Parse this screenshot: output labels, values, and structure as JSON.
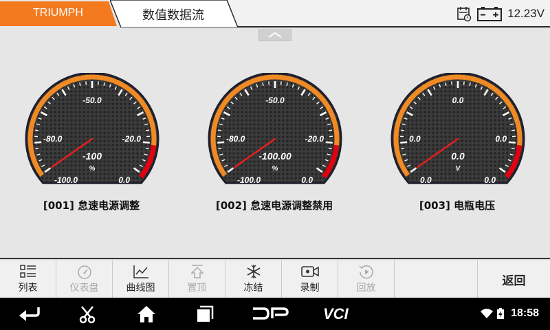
{
  "header": {
    "brand": "TRIUMPH",
    "title": "数值数据流",
    "voltage": "12.23V",
    "icons": [
      "calendar-clock-icon",
      "battery-icon"
    ]
  },
  "gauges": [
    {
      "ticks": {
        "top": "-50.0",
        "left": "-80.0",
        "right": "-20.0",
        "bottom_left": "-100.0",
        "bottom_right": "0.0"
      },
      "value": "-100",
      "unit": "%",
      "label": "[001] 怠速电源调整"
    },
    {
      "ticks": {
        "top": "-50.0",
        "left": "-80.0",
        "right": "-20.0",
        "bottom_left": "-100.0",
        "bottom_right": "0.0"
      },
      "value": "-100.00",
      "unit": "%",
      "label": "[002] 怠速电源调整禁用"
    },
    {
      "ticks": {
        "top": "0.0",
        "left": "0.0",
        "right": "0.0",
        "bottom_left": "0.0",
        "bottom_right": "0.0"
      },
      "value": "0.0",
      "unit": "V",
      "label": "[003] 电瓶电压"
    }
  ],
  "toolbar": {
    "items": [
      {
        "label": "列表",
        "icon": "list-icon",
        "enabled": true
      },
      {
        "label": "仪表盘",
        "icon": "gauge-icon",
        "enabled": false
      },
      {
        "label": "曲线图",
        "icon": "line-chart-icon",
        "enabled": true
      },
      {
        "label": "置顶",
        "icon": "pin-top-icon",
        "enabled": false
      },
      {
        "label": "冻结",
        "icon": "snowflake-icon",
        "enabled": true
      },
      {
        "label": "录制",
        "icon": "video-record-icon",
        "enabled": true
      },
      {
        "label": "回放",
        "icon": "replay-icon",
        "enabled": false
      }
    ],
    "back": "返回"
  },
  "navbar": {
    "clock": "18:58",
    "dp_logo": "DP",
    "vci_logo": "VCI"
  },
  "colors": {
    "brand_orange": "#f47a20",
    "gauge_orange": "#f08a24",
    "gauge_red": "#e3000f",
    "needle": "#e61e1e"
  }
}
